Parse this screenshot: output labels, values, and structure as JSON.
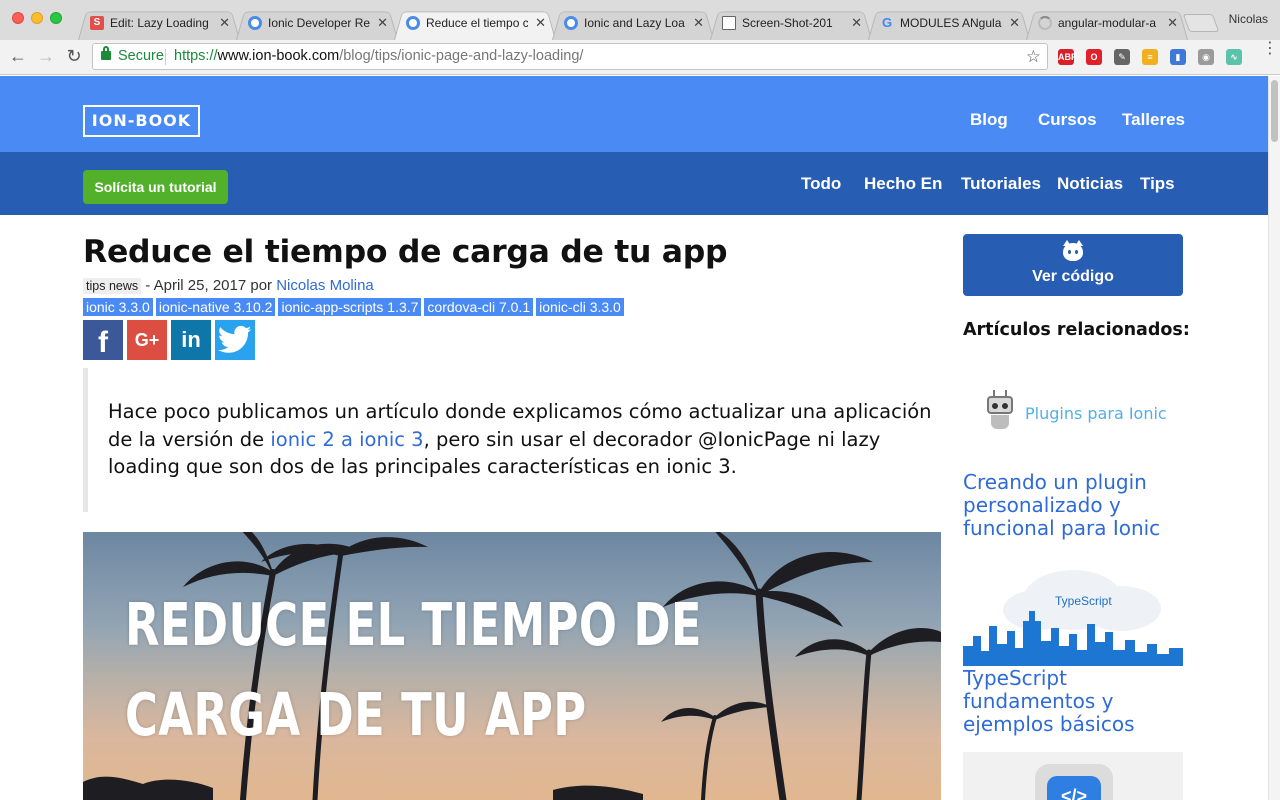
{
  "browser": {
    "tabs": [
      {
        "title": "Edit: Lazy Loading",
        "icon": "s-favicon"
      },
      {
        "title": "Ionic Developer Re",
        "icon": "ring-favicon"
      },
      {
        "title": "Reduce el tiempo c",
        "icon": "ring-favicon"
      },
      {
        "title": "Ionic and Lazy Loa",
        "icon": "ring-favicon"
      },
      {
        "title": "Screen-Shot-201",
        "icon": "doc-favicon"
      },
      {
        "title": "MODULES ANgula",
        "icon": "google-favicon"
      },
      {
        "title": "angular-modular-a",
        "icon": "loading-favicon"
      }
    ],
    "tab_close": "✕",
    "profile_name": "Nicolas",
    "secure_label": "Secure",
    "url_scheme": "https://",
    "url_host": "www.ion-book.com",
    "url_path": "/blog/tips/ionic-page-and-lazy-loading/",
    "back": "←",
    "forward": "→",
    "reload": "↻",
    "bookmark": "☆",
    "extensions": [
      {
        "name": "adblock-icon",
        "label": "ABP",
        "color": "#d8202a"
      },
      {
        "name": "opera-icon",
        "label": "O",
        "color": "#e0202a"
      },
      {
        "name": "eyedropper-icon",
        "label": "✎",
        "color": "#666666"
      },
      {
        "name": "notes-icon",
        "label": "≡",
        "color": "#f2b01e"
      },
      {
        "name": "ext-blue-icon",
        "label": "▮",
        "color": "#4078d8"
      },
      {
        "name": "camera-icon",
        "label": "◉",
        "color": "#9a9a9a"
      },
      {
        "name": "wave-icon",
        "label": "∿",
        "color": "#5cc3a8"
      }
    ],
    "menu": "⋮"
  },
  "site": {
    "logo": "ION-BOOK",
    "nav": [
      "Blog",
      "Cursos",
      "Talleres"
    ],
    "cta": "Solícita un tutorial",
    "categories": [
      "Todo",
      "Hecho En",
      "Tutoriales",
      "Noticias",
      "Tips"
    ]
  },
  "article": {
    "title": "Reduce el tiempo de carga de tu app",
    "tags": [
      "tips",
      "news"
    ],
    "date_prefix": " - April 25, 2017 por ",
    "author": "Nicolas Molina",
    "versions": [
      "ionic  3.3.0",
      "ionic-native  3.10.2",
      "ionic-app-scripts  1.3.7",
      "cordova-cli  7.0.1",
      "ionic-cli  3.3.0"
    ],
    "share": [
      {
        "name": "facebook-share-button",
        "glyph": "f"
      },
      {
        "name": "google-plus-share-button",
        "glyph": "G+"
      },
      {
        "name": "linkedin-share-button",
        "glyph": "in"
      },
      {
        "name": "twitter-share-button",
        "glyph": "🐦"
      }
    ],
    "quote_before": "Hace poco publicamos un artículo donde explicamos cómo actualizar una aplicación de la versión de ",
    "quote_link": "ionic 2 a ionic 3",
    "quote_after": ", pero sin usar el decorador @IonicPage ni lazy loading que son dos de las principales características en ionic 3.",
    "hero_line1": "REDUCE EL TIEMPO DE",
    "hero_line2": "CARGA DE TU APP"
  },
  "sidebar": {
    "code_button": "Ver código",
    "related_heading": "Artículos relacionados:",
    "related": [
      {
        "thumb_label": "Plugins para Ionic",
        "title": "Creando un plugin personalizado y funcional para Ionic"
      },
      {
        "thumb_label": "TypeScript",
        "title": "TypeScript fundamentos y ejemplos básicos"
      },
      {
        "thumb_label": "",
        "title": ""
      }
    ]
  }
}
